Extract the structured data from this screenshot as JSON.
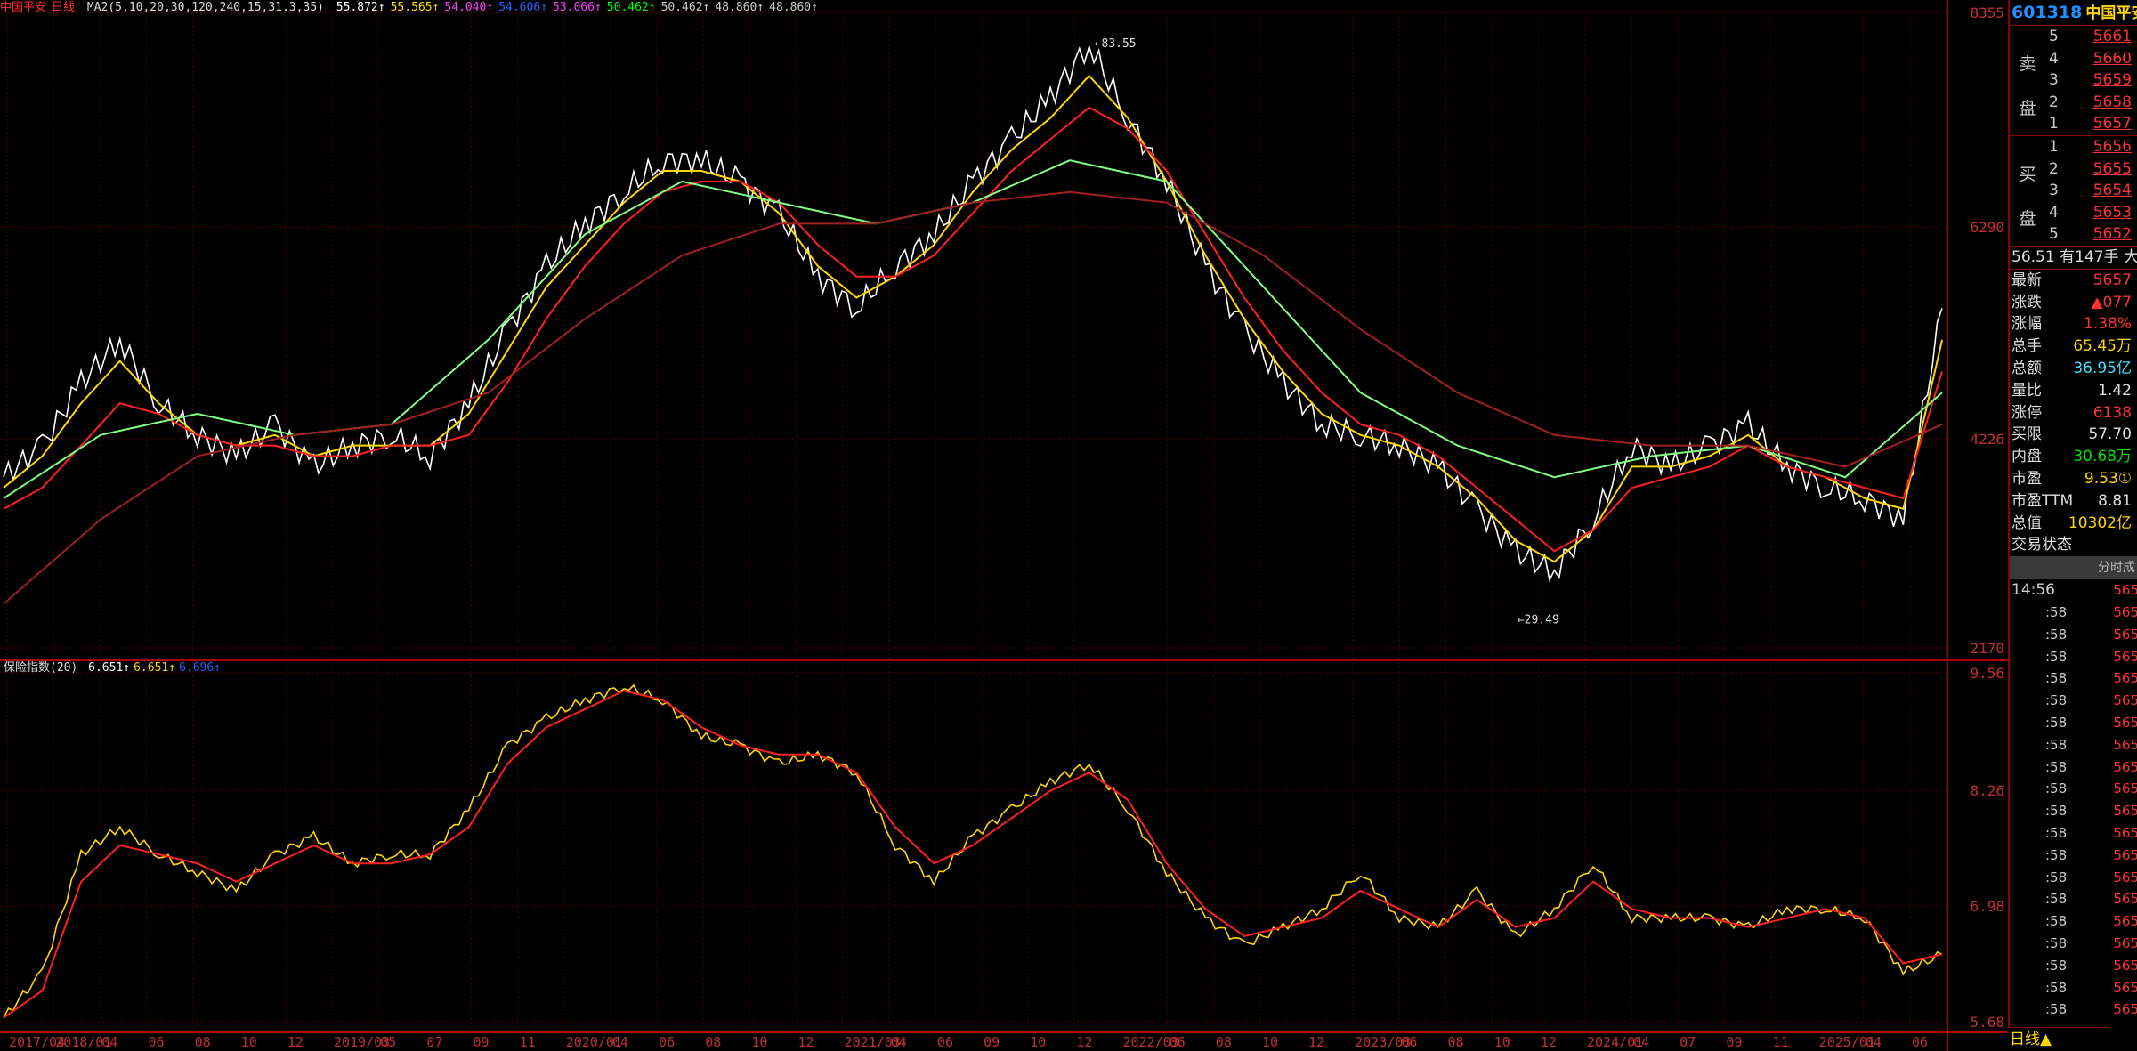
{
  "legend_top": {
    "name": "中国平安",
    "period": "日线",
    "ma_label": "MA2(5,10,20,30,120,240,15,31.3,35)",
    "values": [
      {
        "text": "55.872↑",
        "color": "#ffffff"
      },
      {
        "text": "55.565↑",
        "color": "#ffd700"
      },
      {
        "text": "54.040↑",
        "color": "#ff40ff"
      },
      {
        "text": "54.606↑",
        "color": "#2060ff"
      },
      {
        "text": "53.066↑",
        "color": "#ff40ff"
      },
      {
        "text": "50.462↑",
        "color": "#00ff00"
      },
      {
        "text": "50.462↑",
        "color": "#cccccc"
      },
      {
        "text": "48.860↑",
        "color": "#cccccc"
      },
      {
        "text": "48.860↑",
        "color": "#cccccc"
      }
    ]
  },
  "legend_bottom": {
    "name": "保险指数(20)",
    "values": [
      {
        "text": "6.651↑",
        "color": "#ffffff"
      },
      {
        "text": "6.651↑",
        "color": "#ffd700"
      },
      {
        "text": "6.696↑",
        "color": "#2060ff"
      }
    ]
  },
  "upper_axis_labels": [
    "8355",
    "6290",
    "4226",
    "2170"
  ],
  "lower_axis_labels": [
    "9.56",
    "8.26",
    "6.98",
    "5.68"
  ],
  "annotations": {
    "high": "83.55",
    "low": "29.49"
  },
  "x_tick_labels": [
    "2017/04",
    "2018/01",
    "04",
    "06",
    "08",
    "10",
    "12",
    "2019/03",
    "05",
    "07",
    "09",
    "11",
    "2020/01",
    "04",
    "06",
    "08",
    "10",
    "12",
    "2021/03",
    "04",
    "06",
    "09",
    "10",
    "12",
    "2022/03",
    "06",
    "08",
    "10",
    "12",
    "2023/03",
    "06",
    "08",
    "10",
    "12",
    "2024/01",
    "04",
    "07",
    "09",
    "11",
    "2025/01",
    "04",
    "06"
  ],
  "chart_data": [
    {
      "type": "line",
      "title": "中国平安 日线",
      "ylim": [
        25,
        86
      ],
      "series": [
        {
          "name": "price",
          "color": "#ffffff",
          "x": [
            0,
            2,
            4,
            6,
            8,
            10,
            12,
            14,
            16,
            18,
            20,
            22,
            24,
            26,
            28,
            30,
            32,
            34,
            36,
            38,
            40,
            42,
            44,
            46,
            48,
            50,
            52,
            54,
            56,
            58,
            60,
            62,
            64,
            66,
            68,
            70,
            72,
            74,
            76,
            78,
            80,
            82,
            84,
            86,
            88,
            90,
            92,
            94,
            96,
            98,
            100
          ],
          "values": [
            42,
            45,
            51,
            55,
            49,
            46,
            44,
            47,
            43,
            45,
            46,
            44,
            49,
            56,
            62,
            66,
            69,
            72,
            72,
            70,
            67,
            61,
            58,
            62,
            65,
            70,
            74,
            78,
            83,
            76,
            70,
            62,
            56,
            51,
            47,
            46,
            45,
            43,
            39,
            35,
            33,
            38,
            45,
            43,
            45,
            47,
            43,
            41,
            40,
            38,
            58
          ]
        },
        {
          "name": "MA5",
          "color": "#ffd700",
          "x": [
            0,
            2,
            4,
            6,
            8,
            10,
            12,
            14,
            16,
            18,
            20,
            22,
            24,
            26,
            28,
            30,
            32,
            34,
            36,
            38,
            40,
            42,
            44,
            46,
            48,
            50,
            52,
            54,
            56,
            58,
            60,
            62,
            64,
            66,
            68,
            70,
            72,
            74,
            76,
            78,
            80,
            82,
            84,
            86,
            88,
            90,
            92,
            94,
            96,
            98,
            100
          ],
          "values": [
            41,
            44,
            49,
            53,
            49,
            46,
            45,
            46,
            44,
            45,
            45,
            45,
            48,
            54,
            60,
            64,
            68,
            71,
            71,
            70,
            67,
            62,
            59,
            61,
            64,
            69,
            73,
            76,
            80,
            76,
            70,
            63,
            57,
            52,
            48,
            46,
            45,
            43,
            40,
            36,
            34,
            37,
            43,
            43,
            44,
            46,
            43,
            42,
            40,
            39,
            55
          ]
        },
        {
          "name": "MA20",
          "color": "#ff2020",
          "x": [
            0,
            2,
            4,
            6,
            8,
            10,
            12,
            14,
            16,
            18,
            20,
            22,
            24,
            26,
            28,
            30,
            32,
            34,
            36,
            38,
            40,
            42,
            44,
            46,
            48,
            50,
            52,
            54,
            56,
            58,
            60,
            62,
            64,
            66,
            68,
            70,
            72,
            74,
            76,
            78,
            80,
            82,
            84,
            86,
            88,
            90,
            92,
            94,
            96,
            98,
            100
          ],
          "values": [
            39,
            41,
            45,
            49,
            48,
            46,
            45,
            45,
            44,
            44,
            45,
            45,
            46,
            51,
            57,
            62,
            66,
            69,
            70,
            70,
            68,
            64,
            61,
            61,
            63,
            67,
            71,
            74,
            77,
            75,
            71,
            65,
            59,
            54,
            50,
            47,
            46,
            44,
            41,
            38,
            35,
            37,
            41,
            42,
            43,
            45,
            43,
            42,
            41,
            40,
            52
          ]
        },
        {
          "name": "MA120",
          "color": "#80ff80",
          "x": [
            0,
            5,
            10,
            15,
            20,
            25,
            30,
            35,
            40,
            45,
            50,
            55,
            60,
            65,
            70,
            75,
            80,
            85,
            90,
            95,
            100
          ],
          "values": [
            40,
            46,
            48,
            46,
            47,
            55,
            65,
            70,
            68,
            66,
            68,
            72,
            70,
            60,
            50,
            45,
            42,
            44,
            45,
            42,
            50
          ]
        },
        {
          "name": "MA240",
          "color": "#a02020",
          "x": [
            0,
            5,
            10,
            15,
            20,
            25,
            30,
            35,
            40,
            45,
            50,
            55,
            60,
            65,
            70,
            75,
            80,
            85,
            90,
            95,
            100
          ],
          "values": [
            30,
            38,
            44,
            46,
            47,
            50,
            57,
            63,
            66,
            66,
            68,
            69,
            68,
            63,
            56,
            50,
            46,
            45,
            45,
            43,
            47
          ]
        }
      ]
    },
    {
      "type": "line",
      "title": "保险指数(20)",
      "ylim": [
        5.68,
        9.56
      ],
      "series": [
        {
          "name": "index",
          "color": "#ffd700",
          "x": [
            0,
            2,
            4,
            6,
            8,
            10,
            12,
            14,
            16,
            18,
            20,
            22,
            24,
            26,
            28,
            30,
            32,
            34,
            36,
            38,
            40,
            42,
            44,
            46,
            48,
            50,
            52,
            54,
            56,
            58,
            60,
            62,
            64,
            66,
            68,
            70,
            72,
            74,
            76,
            78,
            80,
            82,
            84,
            86,
            88,
            90,
            92,
            94,
            96,
            98,
            100
          ],
          "values": [
            5.8,
            6.3,
            7.6,
            7.9,
            7.6,
            7.4,
            7.2,
            7.6,
            7.8,
            7.5,
            7.6,
            7.6,
            8.1,
            8.8,
            9.1,
            9.3,
            9.45,
            9.3,
            8.9,
            8.8,
            8.6,
            8.7,
            8.5,
            7.7,
            7.3,
            7.8,
            8.1,
            8.4,
            8.6,
            8.1,
            7.4,
            6.9,
            6.6,
            6.8,
            7.0,
            7.4,
            6.9,
            6.8,
            7.2,
            6.7,
            7.0,
            7.5,
            6.9,
            6.9,
            6.9,
            6.8,
            7.0,
            7.0,
            6.9,
            6.3,
            6.5
          ]
        },
        {
          "name": "MA",
          "color": "#ff2020",
          "x": [
            0,
            2,
            4,
            6,
            8,
            10,
            12,
            14,
            16,
            18,
            20,
            22,
            24,
            26,
            28,
            30,
            32,
            34,
            36,
            38,
            40,
            42,
            44,
            46,
            48,
            50,
            52,
            54,
            56,
            58,
            60,
            62,
            64,
            66,
            68,
            70,
            72,
            74,
            76,
            78,
            80,
            82,
            84,
            86,
            88,
            90,
            92,
            94,
            96,
            98,
            100
          ],
          "values": [
            5.8,
            6.1,
            7.3,
            7.7,
            7.6,
            7.5,
            7.3,
            7.5,
            7.7,
            7.5,
            7.5,
            7.6,
            7.9,
            8.6,
            9.0,
            9.2,
            9.4,
            9.3,
            9.0,
            8.8,
            8.7,
            8.7,
            8.5,
            7.9,
            7.5,
            7.7,
            8.0,
            8.3,
            8.5,
            8.2,
            7.5,
            7.0,
            6.7,
            6.8,
            6.9,
            7.2,
            7.0,
            6.8,
            7.1,
            6.8,
            6.9,
            7.3,
            7.0,
            6.9,
            6.9,
            6.8,
            6.9,
            7.0,
            6.9,
            6.4,
            6.5
          ]
        }
      ]
    }
  ],
  "panel": {
    "code": "601318",
    "name": "中国平安",
    "sell_label": [
      "卖",
      "盘"
    ],
    "buy_label": [
      "买",
      "盘"
    ],
    "sell": [
      {
        "lvl": "5",
        "price": "5661"
      },
      {
        "lvl": "4",
        "price": "5660"
      },
      {
        "lvl": "3",
        "price": "5659"
      },
      {
        "lvl": "2",
        "price": "5658"
      },
      {
        "lvl": "1",
        "price": "5657"
      }
    ],
    "buy": [
      {
        "lvl": "1",
        "price": "5656"
      },
      {
        "lvl": "2",
        "price": "5655"
      },
      {
        "lvl": "3",
        "price": "5654"
      },
      {
        "lvl": "4",
        "price": "5653"
      },
      {
        "lvl": "5",
        "price": "5652"
      }
    ],
    "order_line": {
      "price": "56.51",
      "text": "有147手 大"
    },
    "stats": [
      {
        "k": "最新",
        "v": "5657",
        "c": "red"
      },
      {
        "k": "涨跌",
        "v": "▲077",
        "c": "red"
      },
      {
        "k": "涨幅",
        "v": "1.38%",
        "c": "red"
      },
      {
        "k": "总手",
        "v": "65.45万",
        "c": "yel"
      },
      {
        "k": "总额",
        "v": "36.95亿",
        "c": "cyan"
      },
      {
        "k": "量比",
        "v": "1.42",
        "c": "wht"
      },
      {
        "k": "涨停",
        "v": "6138",
        "c": "red"
      },
      {
        "k": "买限",
        "v": "57.70",
        "c": "wht"
      },
      {
        "k": "内盘",
        "v": "30.68万",
        "c": "grn"
      },
      {
        "k": "市盈",
        "v": "9.53①",
        "c": "yel"
      },
      {
        "k": "市盈TTM",
        "v": "8.81",
        "c": "wht"
      },
      {
        "k": "总值",
        "v": "10302亿",
        "c": "yel"
      },
      {
        "k": "交易状态",
        "v": "",
        "c": "wht"
      }
    ],
    "ticks_header": "分时成",
    "ticks": [
      {
        "t": "14:56",
        "p": "565"
      },
      {
        "t": ":58",
        "p": "565"
      },
      {
        "t": ":58",
        "p": "565"
      },
      {
        "t": ":58",
        "p": "565"
      },
      {
        "t": ":58",
        "p": "565"
      },
      {
        "t": ":58",
        "p": "565"
      },
      {
        "t": ":58",
        "p": "565"
      },
      {
        "t": ":58",
        "p": "565"
      },
      {
        "t": ":58",
        "p": "565"
      },
      {
        "t": ":58",
        "p": "565"
      },
      {
        "t": ":58",
        "p": "565"
      },
      {
        "t": ":58",
        "p": "565"
      },
      {
        "t": ":58",
        "p": "565"
      },
      {
        "t": ":58",
        "p": "565"
      },
      {
        "t": ":58",
        "p": "565"
      },
      {
        "t": ":58",
        "p": "565"
      },
      {
        "t": ":58",
        "p": "565"
      },
      {
        "t": ":58",
        "p": "565"
      },
      {
        "t": ":58",
        "p": "565"
      },
      {
        "t": ":58",
        "p": "565"
      }
    ]
  },
  "period_button": "日线▲"
}
